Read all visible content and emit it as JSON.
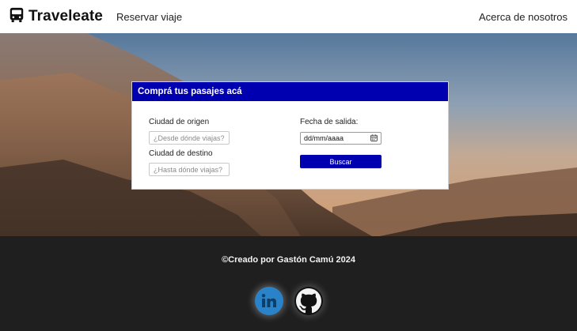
{
  "navbar": {
    "brand": "Traveleate",
    "brand_icon": "bus-icon",
    "links": [
      {
        "label": "Reservar viaje"
      },
      {
        "label": "Acerca de nosotros"
      }
    ]
  },
  "hero": {
    "background": "mountain-landscape-photo"
  },
  "form": {
    "title": "Comprá tus pasajes acá",
    "origin": {
      "label": "Ciudad de origen",
      "placeholder": "¿Desde dónde viajas?",
      "value": ""
    },
    "destination": {
      "label": "Ciudad de destino",
      "placeholder": "¿Hasta dónde viajas?",
      "value": ""
    },
    "departure": {
      "label": "Fecha de salida:",
      "value": "dd/mm/aaaa",
      "icon": "calendar-icon"
    },
    "submit_label": "Buscar"
  },
  "footer": {
    "credit": "©Creado por Gastón Camú 2024",
    "social": [
      {
        "name": "linkedin",
        "icon": "linkedin-icon"
      },
      {
        "name": "github",
        "icon": "github-icon"
      }
    ]
  },
  "colors": {
    "accent": "#0000b0",
    "footer_bg": "#1f1f1f",
    "navbar_bg": "#ffffff",
    "linkedin": "#2a82c8"
  }
}
